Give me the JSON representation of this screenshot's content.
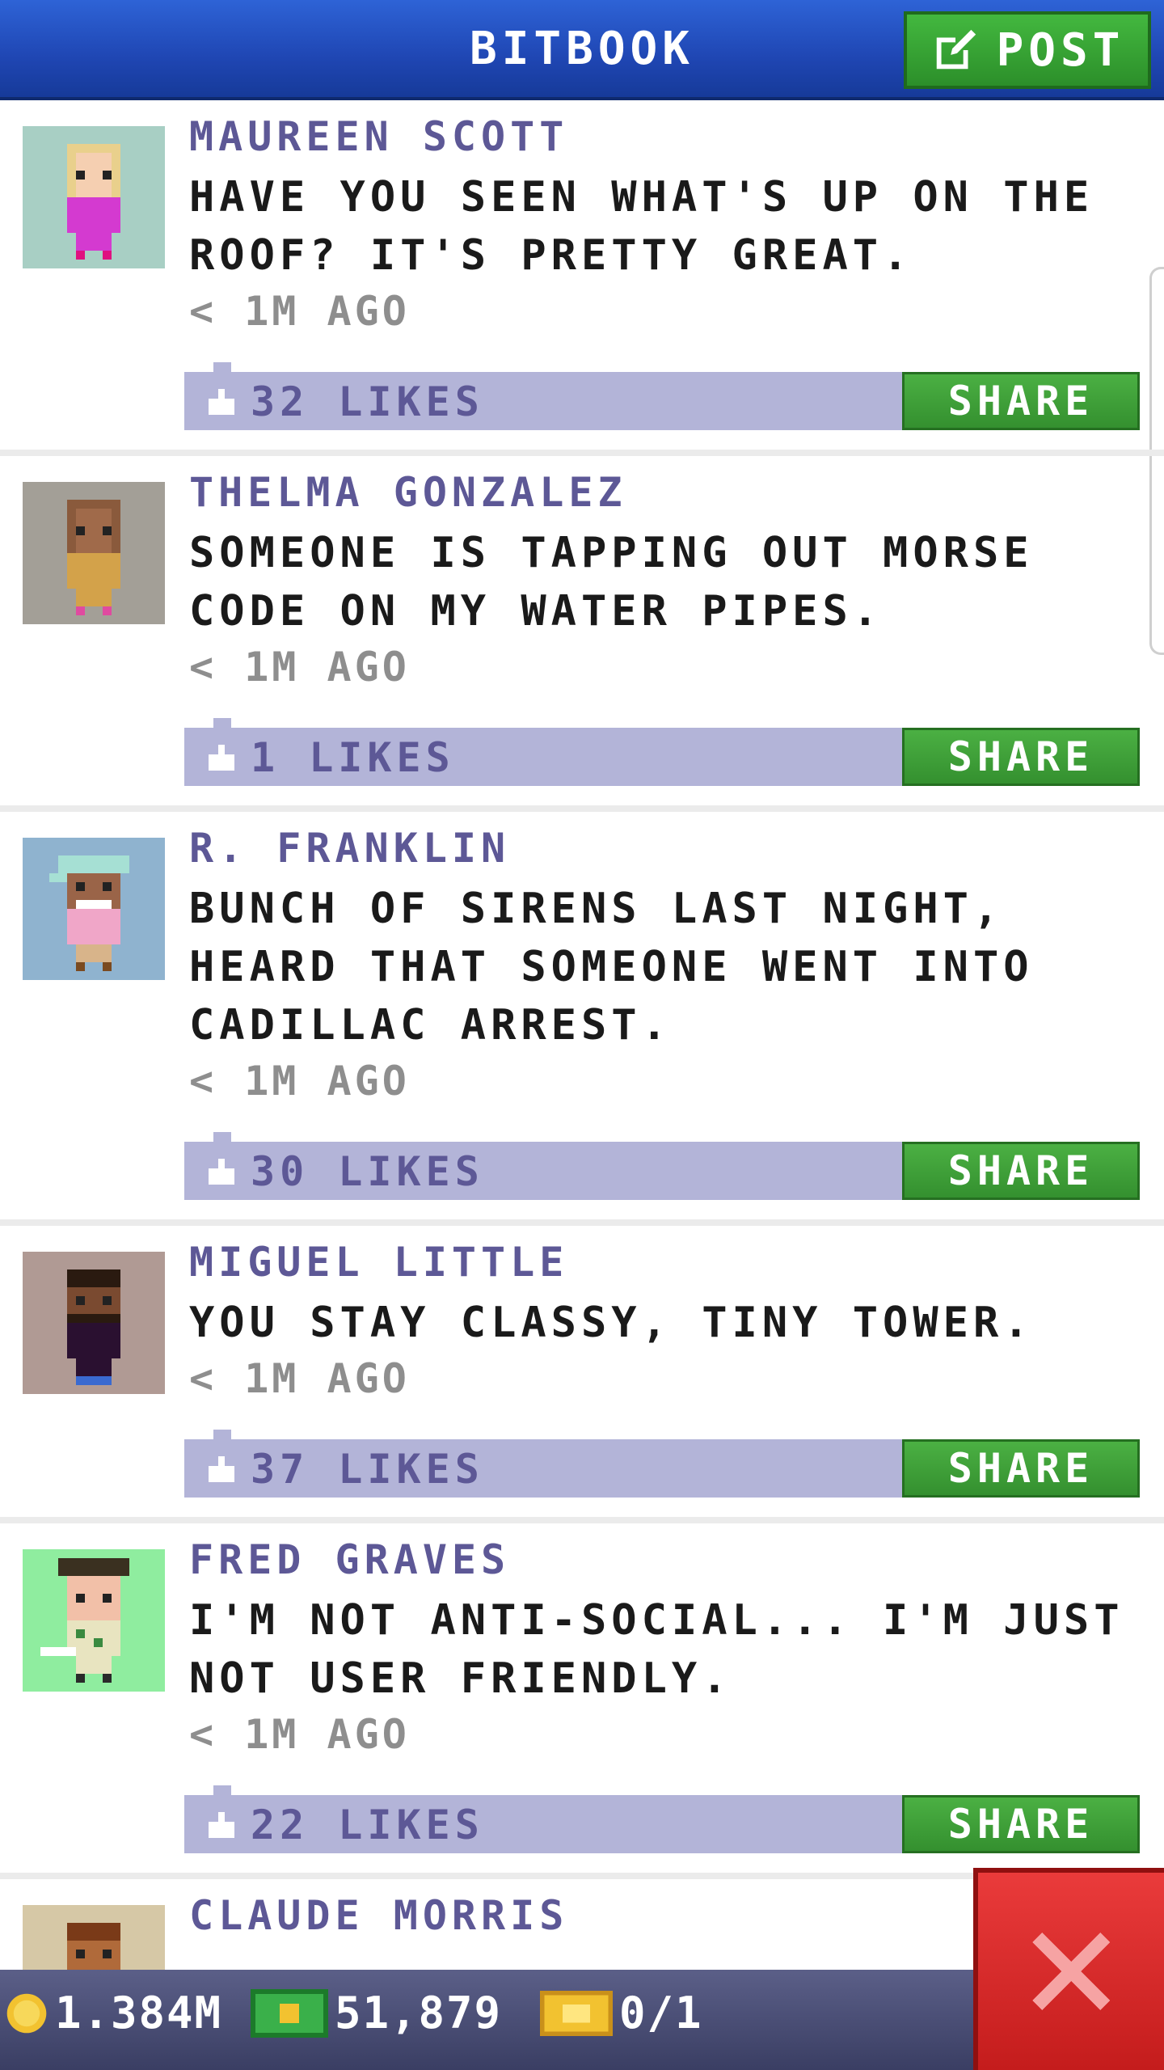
{
  "header": {
    "title": "BITBOOK",
    "post_label": "POST",
    "post_icon": "edit-icon",
    "color": "#1f46b3"
  },
  "posts": [
    {
      "author": "MAUREEN SCOTT",
      "text": "HAVE YOU SEEN WHAT'S UP ON THE ROOF? IT'S PRETTY GREAT.",
      "time": "< 1M AGO",
      "likes": "32 LIKES",
      "share": "SHARE",
      "avatar_bg": "#a8cfc4",
      "avatar": "blonde-woman-avatar"
    },
    {
      "author": "THELMA GONZALEZ",
      "text": "SOMEONE IS TAPPING OUT MORSE CODE ON MY WATER PIPES.",
      "time": "< 1M AGO",
      "likes": "1 LIKES",
      "share": "SHARE",
      "avatar_bg": "#a39f97",
      "avatar": "woman-avatar"
    },
    {
      "author": "R. FRANKLIN",
      "text": "BUNCH OF SIRENS LAST NIGHT, HEARD THAT SOMEONE WENT INTO CADILLAC ARREST.",
      "time": "< 1M AGO",
      "likes": "30 LIKES",
      "share": "SHARE",
      "avatar_bg": "#8fb3cf",
      "avatar": "capped-man-avatar"
    },
    {
      "author": "MIGUEL LITTLE",
      "text": "YOU STAY CLASSY, TINY TOWER.",
      "time": "< 1M AGO",
      "likes": "37 LIKES",
      "share": "SHARE",
      "avatar_bg": "#b09a94",
      "avatar": "bearded-man-avatar"
    },
    {
      "author": "FRED GRAVES",
      "text": "I'M NOT ANTI-SOCIAL... I'M JUST NOT USER FRIENDLY.",
      "time": "< 1M AGO",
      "likes": "22 LIKES",
      "share": "SHARE",
      "avatar_bg": "#8fed9f",
      "avatar": "golfer-avatar"
    },
    {
      "author": "CLAUDE MORRIS",
      "avatar_bg": "#d6c8a6",
      "avatar": "man-avatar"
    }
  ],
  "bottom_bar": {
    "coins": "1.384M",
    "bux": "51,879",
    "tickets": "0/1"
  },
  "close": {
    "icon": "close-icon",
    "color": "#d62828"
  }
}
